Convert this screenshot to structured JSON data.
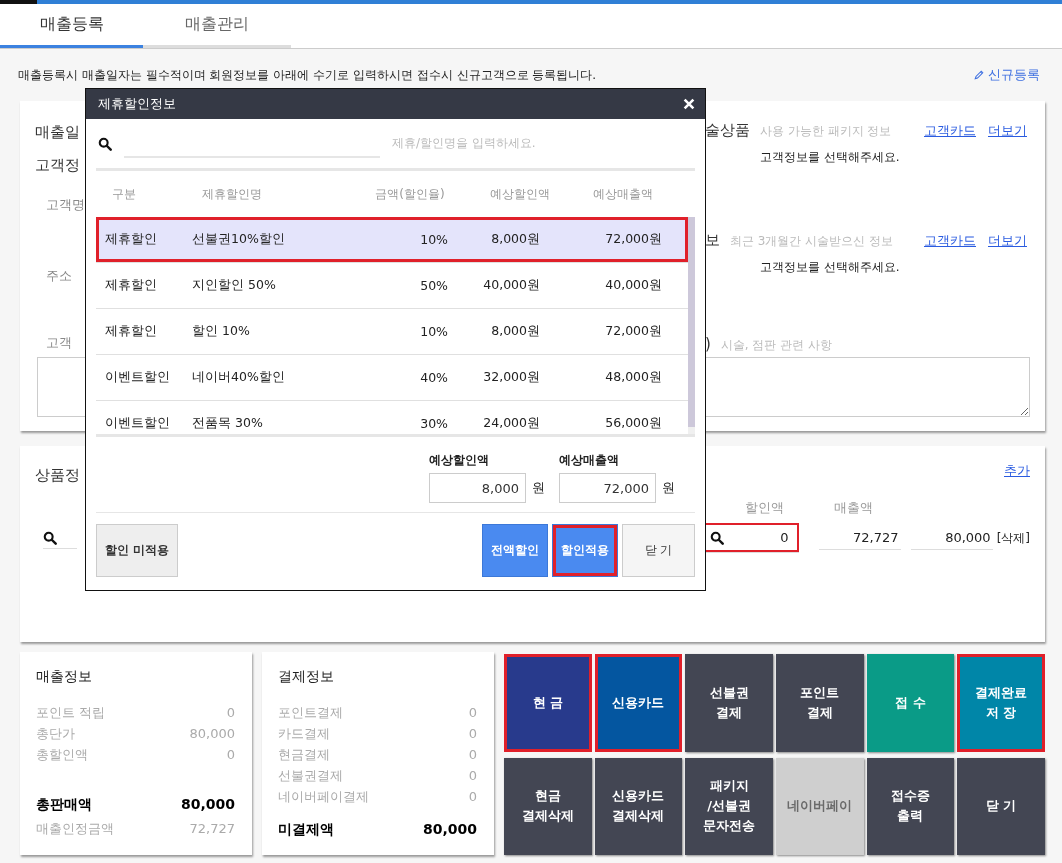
{
  "tabs": [
    {
      "label": "매출등록",
      "selected": true
    },
    {
      "label": "매출관리",
      "selected": false
    }
  ],
  "notice": "매출등록시 매출일자는 필수적이며 회원정보를 아래에 수기로 입력하시면 접수시 신규고객으로 등록됩니다.",
  "new_link": "신규등록",
  "customer_panel": {
    "sale_date_label": "매출일",
    "customer_heading": "고객정",
    "fields": [
      "고객명",
      "주소",
      "고객"
    ],
    "sections": [
      {
        "title": "술상품",
        "hint": "사용 가능한 패키지 정보",
        "links": [
          "고객카드",
          "더보기"
        ],
        "message": "고객정보를 선택해주세요."
      },
      {
        "title": "보",
        "hint": "최근 3개월간 시술받으신 정보",
        "links": [
          "고객카드",
          "더보기"
        ],
        "message": "고객정보를 선택해주세요."
      }
    ],
    "memo": {
      "title": ")",
      "hint": "시술, 점판 관련 사항"
    }
  },
  "product_panel": {
    "title": "상품정",
    "add_link": "추가",
    "columns": [
      "할인액",
      "매출액"
    ],
    "row": {
      "discount": "0",
      "discount_highlighted": true,
      "amount": "72,727",
      "sales": "80,000",
      "delete": "[삭제]"
    }
  },
  "sales_info": {
    "title": "매출정보",
    "rows": [
      {
        "label": "포인트 적립",
        "value": "0"
      },
      {
        "label": "총단가",
        "value": "80,000"
      },
      {
        "label": "총할인액",
        "value": "0"
      }
    ],
    "total": {
      "label": "총판매액",
      "value": "80,000"
    },
    "recognized": {
      "label": "매출인정금액",
      "value": "72,727"
    }
  },
  "payment_info": {
    "title": "결제정보",
    "rows": [
      {
        "label": "포인트결제",
        "value": "0"
      },
      {
        "label": "카드결제",
        "value": "0"
      },
      {
        "label": "현금결제",
        "value": "0"
      },
      {
        "label": "선불권결제",
        "value": "0"
      },
      {
        "label": "네이버페이결제",
        "value": "0"
      }
    ],
    "unpaid": {
      "label": "미결제액",
      "value": "80,000"
    }
  },
  "action_buttons": [
    {
      "label": "현 금",
      "color": "#283a8c",
      "disabled": false,
      "highlighted": true
    },
    {
      "label": "신용카드",
      "color": "#0456a0",
      "disabled": false,
      "highlighted": true
    },
    {
      "label": "선불권\n결제",
      "color": "#434653",
      "disabled": false,
      "highlighted": false
    },
    {
      "label": "포인트\n결제",
      "color": "#434653",
      "disabled": false,
      "highlighted": false
    },
    {
      "label": "접 수",
      "color": "#0a9b87",
      "disabled": false,
      "highlighted": false
    },
    {
      "label": "결제완료\n저 장",
      "color": "#0086a8",
      "disabled": false,
      "highlighted": true
    },
    {
      "label": "현금\n결제삭제",
      "color": "#434653",
      "disabled": false,
      "highlighted": false
    },
    {
      "label": "신용카드\n결제삭제",
      "color": "#434653",
      "disabled": false,
      "highlighted": false
    },
    {
      "label": "패키지\n/선불권\n문자전송",
      "color": "#434653",
      "disabled": false,
      "highlighted": false
    },
    {
      "label": "네이버페이",
      "color": "#cfcfcf",
      "disabled": true,
      "highlighted": false
    },
    {
      "label": "접수증\n출력",
      "color": "#434653",
      "disabled": false,
      "highlighted": false
    },
    {
      "label": "닫 기",
      "color": "#434653",
      "disabled": false,
      "highlighted": false
    }
  ],
  "dialog": {
    "title": "제휴할인정보",
    "search_hint": "제휴/할인명을 입력하세요.",
    "columns": [
      "구분",
      "제휴할인명",
      "금액(할인율)",
      "예상할인액",
      "예상매출액"
    ],
    "rows": [
      {
        "type": "제휴할인",
        "name": "선불권10%할인",
        "rate": "10%",
        "discount": "8,000원",
        "sales": "72,000원",
        "selected": true,
        "highlighted": true
      },
      {
        "type": "제휴할인",
        "name": "지인할인 50%",
        "rate": "50%",
        "discount": "40,000원",
        "sales": "40,000원",
        "selected": false,
        "highlighted": false
      },
      {
        "type": "제휴할인",
        "name": "할인 10%",
        "rate": "10%",
        "discount": "8,000원",
        "sales": "72,000원",
        "selected": false,
        "highlighted": false
      },
      {
        "type": "이벤트할인",
        "name": "네이버40%할인",
        "rate": "40%",
        "discount": "32,000원",
        "sales": "48,000원",
        "selected": false,
        "highlighted": false
      },
      {
        "type": "이벤트할인",
        "name": "전품목 30%",
        "rate": "30%",
        "discount": "24,000원",
        "sales": "56,000원",
        "selected": false,
        "highlighted": false
      }
    ],
    "summary": [
      {
        "label": "예상할인액",
        "value": "8,000",
        "unit": "원"
      },
      {
        "label": "예상매출액",
        "value": "72,000",
        "unit": "원"
      }
    ],
    "buttons": [
      {
        "label": "할인 미적용",
        "kind": "plain",
        "highlighted": false
      },
      {
        "label": "전액할인",
        "kind": "primary",
        "highlighted": false
      },
      {
        "label": "할인적용",
        "kind": "primary",
        "highlighted": true
      },
      {
        "label": "닫 기",
        "kind": "light",
        "highlighted": false
      }
    ]
  }
}
